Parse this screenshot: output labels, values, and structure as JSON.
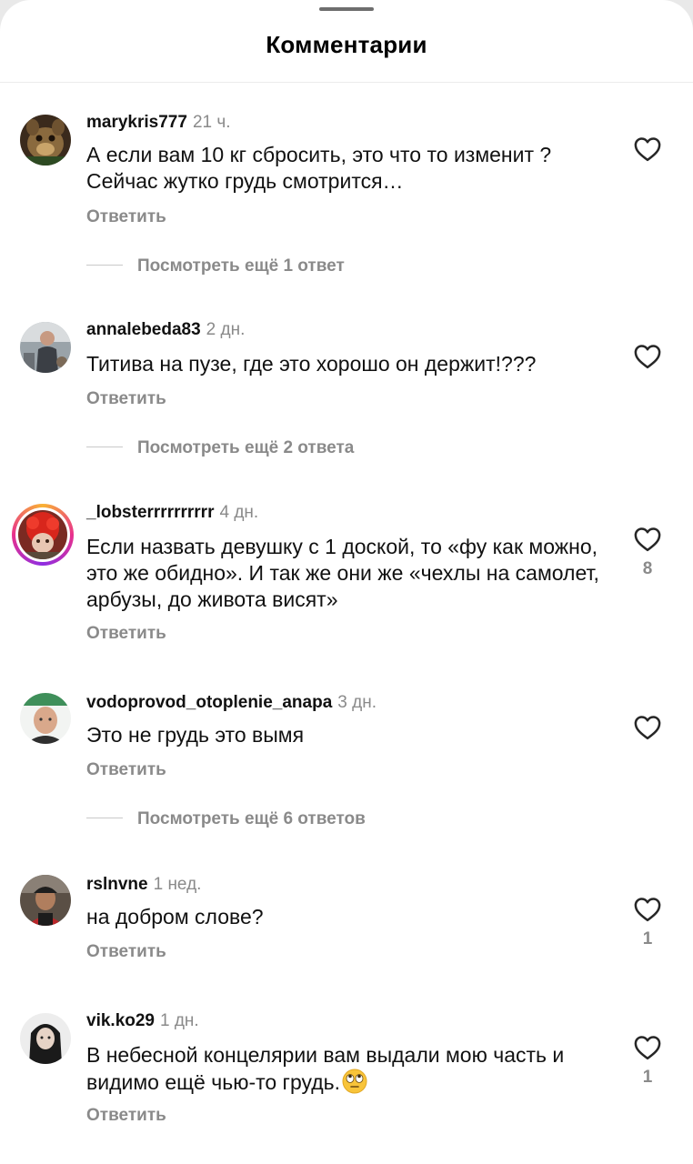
{
  "header": {
    "title": "Комментарии"
  },
  "comments": [
    {
      "username": "marykris777",
      "time": "21 ч.",
      "text": "А если вам 10 кг сбросить, это что то изменит ? Сейчас жутко грудь смотрится…",
      "reply_label": "Ответить",
      "view_replies": "Посмотреть ещё 1 ответ",
      "likes": ""
    },
    {
      "username": "annalebeda83",
      "time": "2 дн.",
      "text": "Титива на пузе, где это хорошо он держит!???",
      "reply_label": "Ответить",
      "view_replies": "Посмотреть ещё 2 ответа",
      "likes": ""
    },
    {
      "username": "_lobsterrrrrrrrrr",
      "time": "4 дн.",
      "text": "Если назвать девушку с 1 доской, то «фу как можно, это же обидно». И так же они же «чехлы на самолет, арбузы, до живота висят»",
      "reply_label": "Ответить",
      "view_replies": "",
      "likes": "8"
    },
    {
      "username": "vodoprovod_otoplenie_anapa",
      "time": "3 дн.",
      "text": "Это не грудь это вымя",
      "reply_label": "Ответить",
      "view_replies": "Посмотреть ещё 6 ответов",
      "likes": ""
    },
    {
      "username": "rslnvne",
      "time": "1 нед.",
      "text": "на добром слове?",
      "reply_label": "Ответить",
      "view_replies": "",
      "likes": "1"
    },
    {
      "username": "vik.ko29",
      "time": "1 дн.",
      "text": "В небесной концелярии вам выдали мою часть и видимо ещё чью-то грудь.",
      "emoji": "face-with-rolling-eyes-emoji",
      "reply_label": "Ответить",
      "view_replies": "",
      "likes": "1"
    }
  ],
  "icons": {
    "like": "heart-outline-icon",
    "handle": "sheet-grabber"
  },
  "colors": {
    "text": "#111111",
    "secondary": "#8a8a8a",
    "story_ring_start": "#f9b233",
    "story_ring_mid": "#e8308c"
  }
}
